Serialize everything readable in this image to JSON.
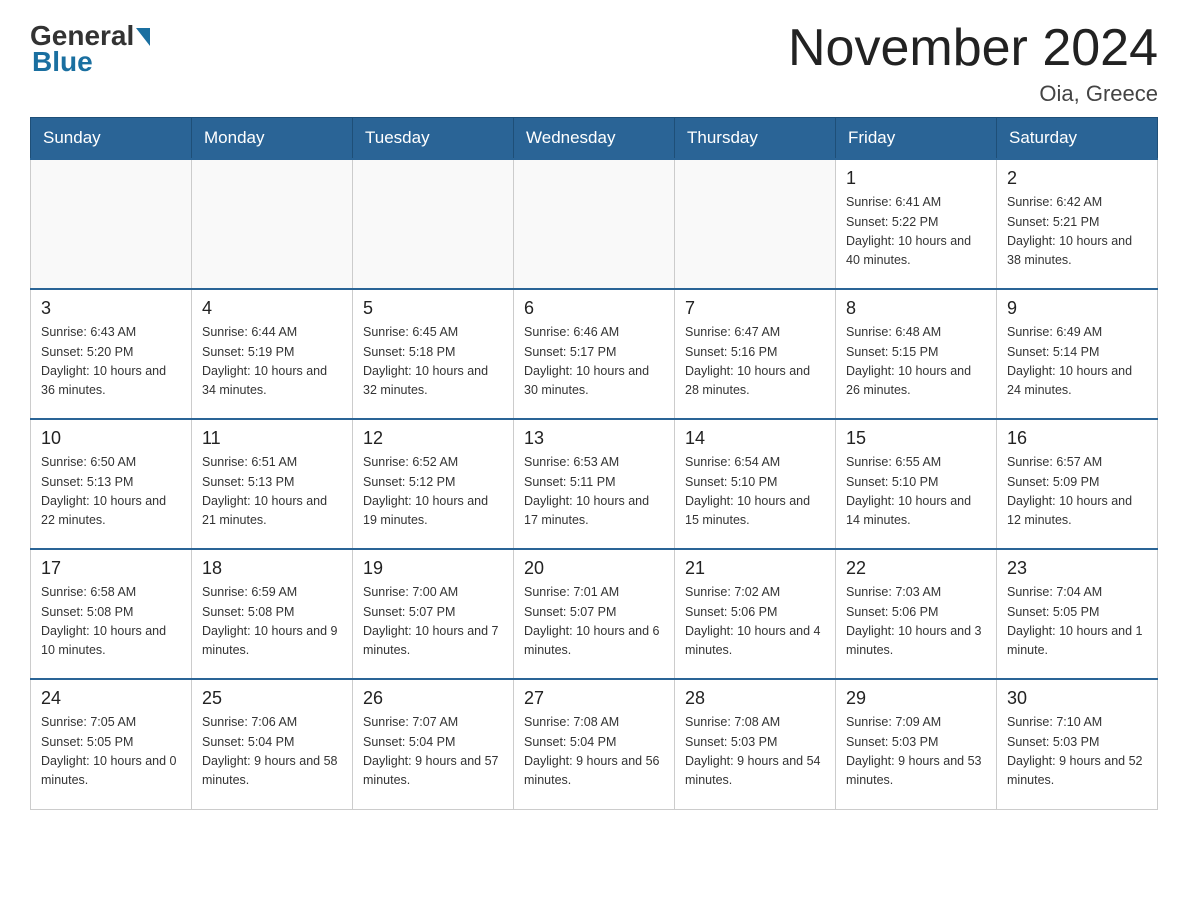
{
  "header": {
    "logo_general": "General",
    "logo_blue": "Blue",
    "month_title": "November 2024",
    "location": "Oia, Greece"
  },
  "days_of_week": [
    "Sunday",
    "Monday",
    "Tuesday",
    "Wednesday",
    "Thursday",
    "Friday",
    "Saturday"
  ],
  "weeks": [
    [
      {
        "day": "",
        "info": ""
      },
      {
        "day": "",
        "info": ""
      },
      {
        "day": "",
        "info": ""
      },
      {
        "day": "",
        "info": ""
      },
      {
        "day": "",
        "info": ""
      },
      {
        "day": "1",
        "info": "Sunrise: 6:41 AM\nSunset: 5:22 PM\nDaylight: 10 hours and 40 minutes."
      },
      {
        "day": "2",
        "info": "Sunrise: 6:42 AM\nSunset: 5:21 PM\nDaylight: 10 hours and 38 minutes."
      }
    ],
    [
      {
        "day": "3",
        "info": "Sunrise: 6:43 AM\nSunset: 5:20 PM\nDaylight: 10 hours and 36 minutes."
      },
      {
        "day": "4",
        "info": "Sunrise: 6:44 AM\nSunset: 5:19 PM\nDaylight: 10 hours and 34 minutes."
      },
      {
        "day": "5",
        "info": "Sunrise: 6:45 AM\nSunset: 5:18 PM\nDaylight: 10 hours and 32 minutes."
      },
      {
        "day": "6",
        "info": "Sunrise: 6:46 AM\nSunset: 5:17 PM\nDaylight: 10 hours and 30 minutes."
      },
      {
        "day": "7",
        "info": "Sunrise: 6:47 AM\nSunset: 5:16 PM\nDaylight: 10 hours and 28 minutes."
      },
      {
        "day": "8",
        "info": "Sunrise: 6:48 AM\nSunset: 5:15 PM\nDaylight: 10 hours and 26 minutes."
      },
      {
        "day": "9",
        "info": "Sunrise: 6:49 AM\nSunset: 5:14 PM\nDaylight: 10 hours and 24 minutes."
      }
    ],
    [
      {
        "day": "10",
        "info": "Sunrise: 6:50 AM\nSunset: 5:13 PM\nDaylight: 10 hours and 22 minutes."
      },
      {
        "day": "11",
        "info": "Sunrise: 6:51 AM\nSunset: 5:13 PM\nDaylight: 10 hours and 21 minutes."
      },
      {
        "day": "12",
        "info": "Sunrise: 6:52 AM\nSunset: 5:12 PM\nDaylight: 10 hours and 19 minutes."
      },
      {
        "day": "13",
        "info": "Sunrise: 6:53 AM\nSunset: 5:11 PM\nDaylight: 10 hours and 17 minutes."
      },
      {
        "day": "14",
        "info": "Sunrise: 6:54 AM\nSunset: 5:10 PM\nDaylight: 10 hours and 15 minutes."
      },
      {
        "day": "15",
        "info": "Sunrise: 6:55 AM\nSunset: 5:10 PM\nDaylight: 10 hours and 14 minutes."
      },
      {
        "day": "16",
        "info": "Sunrise: 6:57 AM\nSunset: 5:09 PM\nDaylight: 10 hours and 12 minutes."
      }
    ],
    [
      {
        "day": "17",
        "info": "Sunrise: 6:58 AM\nSunset: 5:08 PM\nDaylight: 10 hours and 10 minutes."
      },
      {
        "day": "18",
        "info": "Sunrise: 6:59 AM\nSunset: 5:08 PM\nDaylight: 10 hours and 9 minutes."
      },
      {
        "day": "19",
        "info": "Sunrise: 7:00 AM\nSunset: 5:07 PM\nDaylight: 10 hours and 7 minutes."
      },
      {
        "day": "20",
        "info": "Sunrise: 7:01 AM\nSunset: 5:07 PM\nDaylight: 10 hours and 6 minutes."
      },
      {
        "day": "21",
        "info": "Sunrise: 7:02 AM\nSunset: 5:06 PM\nDaylight: 10 hours and 4 minutes."
      },
      {
        "day": "22",
        "info": "Sunrise: 7:03 AM\nSunset: 5:06 PM\nDaylight: 10 hours and 3 minutes."
      },
      {
        "day": "23",
        "info": "Sunrise: 7:04 AM\nSunset: 5:05 PM\nDaylight: 10 hours and 1 minute."
      }
    ],
    [
      {
        "day": "24",
        "info": "Sunrise: 7:05 AM\nSunset: 5:05 PM\nDaylight: 10 hours and 0 minutes."
      },
      {
        "day": "25",
        "info": "Sunrise: 7:06 AM\nSunset: 5:04 PM\nDaylight: 9 hours and 58 minutes."
      },
      {
        "day": "26",
        "info": "Sunrise: 7:07 AM\nSunset: 5:04 PM\nDaylight: 9 hours and 57 minutes."
      },
      {
        "day": "27",
        "info": "Sunrise: 7:08 AM\nSunset: 5:04 PM\nDaylight: 9 hours and 56 minutes."
      },
      {
        "day": "28",
        "info": "Sunrise: 7:08 AM\nSunset: 5:03 PM\nDaylight: 9 hours and 54 minutes."
      },
      {
        "day": "29",
        "info": "Sunrise: 7:09 AM\nSunset: 5:03 PM\nDaylight: 9 hours and 53 minutes."
      },
      {
        "day": "30",
        "info": "Sunrise: 7:10 AM\nSunset: 5:03 PM\nDaylight: 9 hours and 52 minutes."
      }
    ]
  ]
}
